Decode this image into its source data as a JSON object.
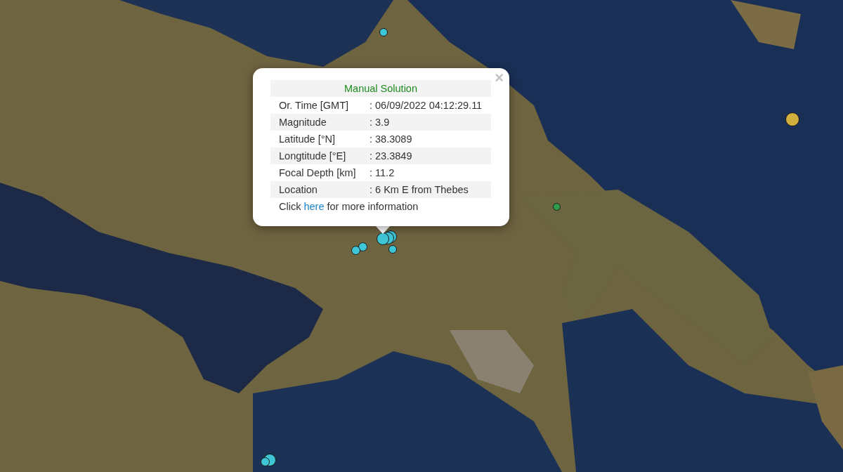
{
  "map": {
    "markers": [
      {
        "color": "#3fc6d6"
      },
      {
        "color": "#d2b03e"
      },
      {
        "color": "#2e9c4c"
      },
      {
        "color": "#3fc6d6"
      },
      {
        "color": "#3fc6d6"
      },
      {
        "color": "#3fc6d6"
      },
      {
        "color": "#3fc6d6"
      },
      {
        "color": "#3fc6d6"
      },
      {
        "color": "#3fc6d6"
      },
      {
        "color": "#3fc6d6"
      },
      {
        "color": "#3fc6d6"
      }
    ]
  },
  "popup": {
    "title": "Manual Solution",
    "rows": [
      {
        "label": "Or. Time [GMT]",
        "value": ": 06/09/2022 04:12:29.11"
      },
      {
        "label": "Magnitude",
        "value": ": 3.9"
      },
      {
        "label": "Latitude [°N]",
        "value": ": 38.3089"
      },
      {
        "label": "Longtitude [°E]",
        "value": ": 23.3849"
      },
      {
        "label": "Focal Depth [km]",
        "value": ": 11.2"
      },
      {
        "label": "Location",
        "value": ": 6 Km E from Thebes"
      }
    ],
    "footer": {
      "before": "Click",
      "link": "here",
      "after": "for more information"
    },
    "close": "×"
  }
}
